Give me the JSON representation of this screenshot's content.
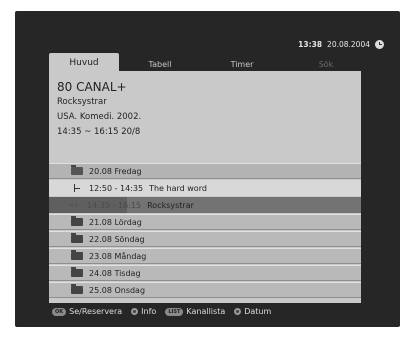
{
  "header": {
    "time": "13:38",
    "date": "20.08.2004"
  },
  "tabs": [
    {
      "label": "Huvud"
    },
    {
      "label": "Tabell"
    },
    {
      "label": "Timer"
    },
    {
      "label": "Sök"
    }
  ],
  "program_info": {
    "channel": "80 CANAL+",
    "title": "Rocksystrar",
    "details": "USA. Komedi. 2002.",
    "time_range": "14:35 ~ 16:15 20/8"
  },
  "list": {
    "day_open": "20.08 Fredag",
    "programs": [
      {
        "time": "12:50 - 14:35",
        "title": "The hard word"
      },
      {
        "time": "14:35 - 16:15",
        "title": "Rocksystrar"
      }
    ],
    "days": [
      "21.08 Lördag",
      "22.08 Söndag",
      "23.08 Måndag",
      "24.08 Tisdag",
      "25.08 Onsdag"
    ]
  },
  "footer": {
    "hints": [
      {
        "key": "OK",
        "label": "Se/Reservera"
      },
      {
        "label": "Info"
      },
      {
        "key": "LIST",
        "label": "Kanallista"
      },
      {
        "label": "Datum"
      }
    ]
  }
}
